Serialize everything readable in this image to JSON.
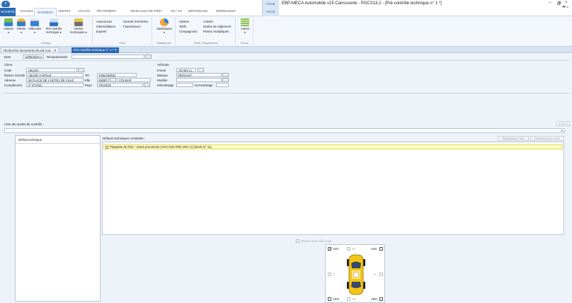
{
  "window": {
    "title": "EBP-MECA Automobile v15 Carrosserie - PGCS13.2 - [Pré-contrôle technique n° 1 *]",
    "context_tab_top": "FICHE",
    "context_tab_bottom": "FICHE",
    "min": "–",
    "restore": "🗗",
    "close": "×",
    "inner_controls": "_ 🗗 ×"
  },
  "ribbon_tabs": [
    "SOCIÉTÉ",
    "ACCUEIL",
    "DONNÉES",
    "VENTES",
    "ACHATS",
    "TRAITEMENT",
    "VÉHICULES DE PRÊT",
    "VN / VO",
    "DÉPANNAGE",
    "IMPRESSION"
  ],
  "ribbon": {
    "garage": {
      "label": "Garage",
      "articles": "Articles",
      "clients": "Clients",
      "vehicules": "Véhicules",
      "precontrole_1": "Pré-contrôle",
      "precontrole_2": "technique ▾",
      "alertes_1": "Alertes",
      "alertes_2": "techniques ▾"
    },
    "tiers": {
      "label": "Tiers",
      "assurances": "Assurances",
      "societe_entretien": "Société d'entretien",
      "intermediaires": "Intermédiaires",
      "fournisseurs": "Fournisseurs",
      "experts": "Experts"
    },
    "statistiques": {
      "label": "Statistiques",
      "button": "Statistiques"
    },
    "tarifs": {
      "label": "Tarifs / Règlements",
      "ateliers": "Ateliers",
      "activite": "Activité",
      "tarifs": "Tarifs",
      "modes": "Modes de règlement",
      "compagnons": "Compagnons",
      "postes": "Postes Analytiques"
    },
    "divers": {
      "label": "Divers",
      "autres": "Autres"
    }
  },
  "doc_tabs": {
    "tab1": "Recherche documents de pré-con... ✕",
    "tab2": "Pré-contrôle technique n° 1 * ✕"
  },
  "form": {
    "date_label": "Date",
    "date_value": "10/05/2010 ▾",
    "receptionnaire_label": "Réceptionnaire",
    "dots": "....",
    "client_header": "Client",
    "code_label": "Code",
    "code_value": "ABLON",
    "raison_label": "Raison Sociale",
    "raison_value": "ABLON CAROLE",
    "tel_label": "Tel",
    "tel_value": "0352433622",
    "adresse_label": "Adresse",
    "adresse_value": "36 PLACE DE L'HOTEL DE VILLE",
    "ville_label": "Ville",
    "cp_value": "68000",
    "ville_value": "COLMAR",
    "complement_label": "Complément",
    "complement_value": "3° ETAGE",
    "pays_label": "Pays",
    "pays_value": "FRANCE",
    "vehicule_header": "Véhicule",
    "immat_label": "Immat",
    "immat_value": "AD 561 LL",
    "marque_label": "Marque",
    "marque_value": "RENAULT",
    "modele_label": "Modèle",
    "modele_value": "",
    "km_label": "Kilométrage",
    "km_value": "",
    "horo_label": "Horométrage",
    "horo_value": ""
  },
  "points": {
    "label": "Liste des points de contrôle :",
    "dropdown": "▾",
    "nav_prev": "◂",
    "nav_next": "▸"
  },
  "defauts": {
    "left_header": "Défaut technique",
    "right_header": "Défauts techniques constatés :",
    "select_all": "Sélectionner Tout",
    "deselect_all": "Désélectionner Tout",
    "row1": "Plaquette de frein - Usure prononcée (AVG AVD ARD ARG C) (Devis N° 11)"
  },
  "wheels": {
    "toute_roue": "Toutes roues déjà vues",
    "avg": "AVG",
    "av": "AV",
    "avd": "AVD",
    "g": "G",
    "d": "D",
    "arg": "ARG",
    "ar": "AR",
    "ard": "ARD",
    "avg_checked": "✓"
  }
}
